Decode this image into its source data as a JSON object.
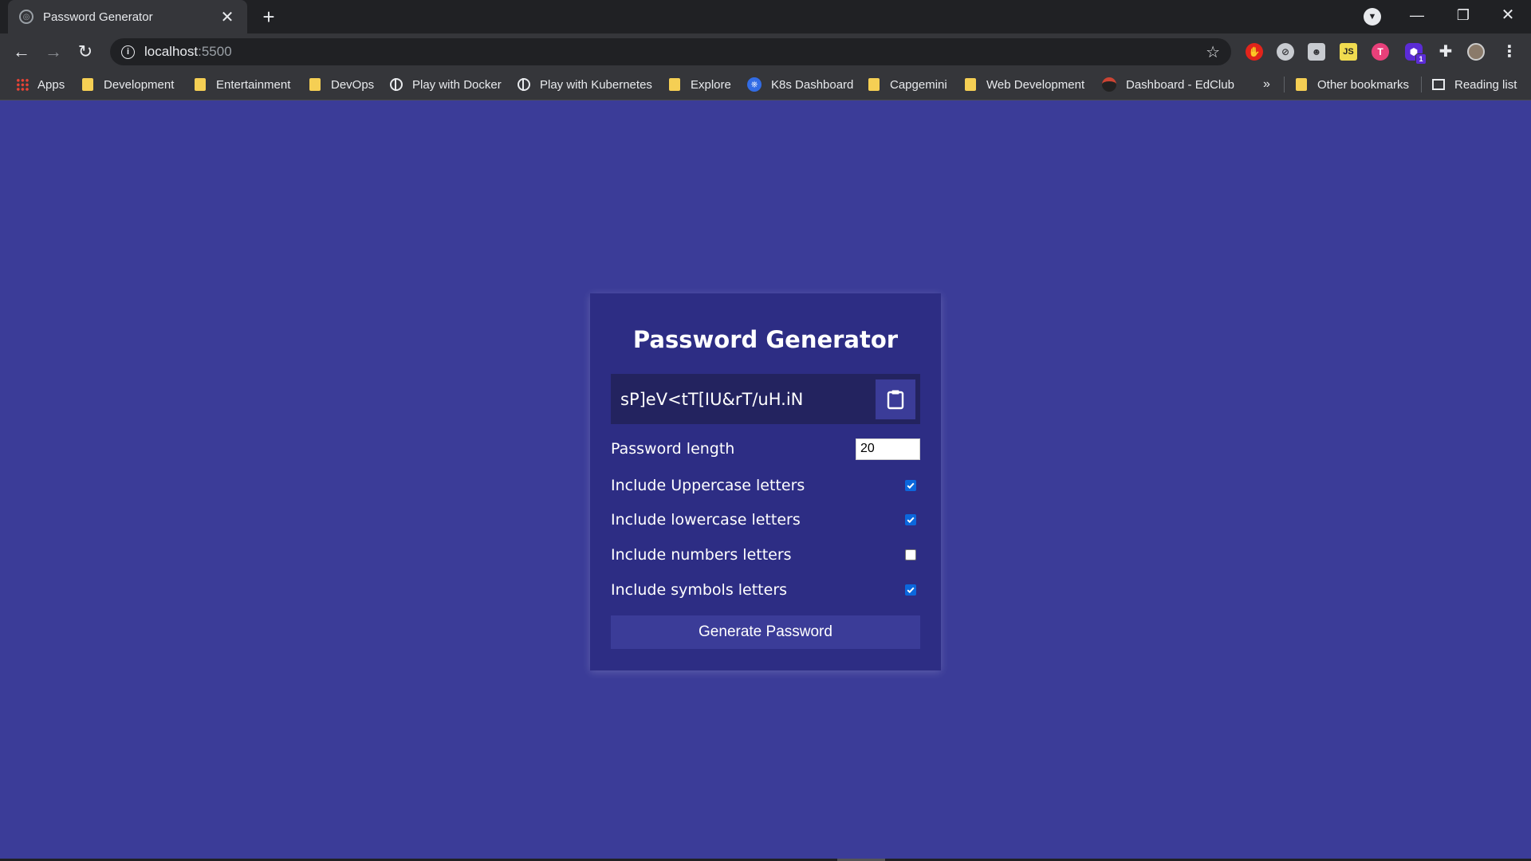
{
  "browser": {
    "tab_title": "Password Generator",
    "url_host": "localhost",
    "url_port": ":5500",
    "bookmarks": [
      {
        "label": "Apps",
        "icon": "apps-grid-icon"
      },
      {
        "label": "Development",
        "icon": "folder-icon"
      },
      {
        "label": "Entertainment",
        "icon": "folder-icon"
      },
      {
        "label": "DevOps",
        "icon": "folder-icon"
      },
      {
        "label": "Play with Docker",
        "icon": "globe-icon"
      },
      {
        "label": "Play with Kubernetes",
        "icon": "globe-icon"
      },
      {
        "label": "Explore",
        "icon": "folder-icon"
      },
      {
        "label": "K8s Dashboard",
        "icon": "kubernetes-icon"
      },
      {
        "label": "Capgemini",
        "icon": "folder-icon"
      },
      {
        "label": "Web Development",
        "icon": "folder-icon"
      },
      {
        "label": "Dashboard - EdClub",
        "icon": "edclub-icon"
      }
    ],
    "overflow_label": "»",
    "other_bookmarks": "Other bookmarks",
    "reading_list": "Reading list",
    "extension_badge": "1"
  },
  "app": {
    "title": "Password Generator",
    "password": "sP]eV<tT[IU&rT/uH.iN",
    "length_label": "Password length",
    "length_value": "20",
    "options": [
      {
        "label": "Include Uppercase letters",
        "checked": true
      },
      {
        "label": "Include lowercase letters",
        "checked": true
      },
      {
        "label": "Include numbers letters",
        "checked": false
      },
      {
        "label": "Include symbols letters",
        "checked": true
      }
    ],
    "generate_label": "Generate Password"
  },
  "colors": {
    "page_bg": "#3b3c98",
    "card_bg": "#2d2d84",
    "result_bg": "#23235f",
    "checkbox_on": "#0b67dd"
  }
}
